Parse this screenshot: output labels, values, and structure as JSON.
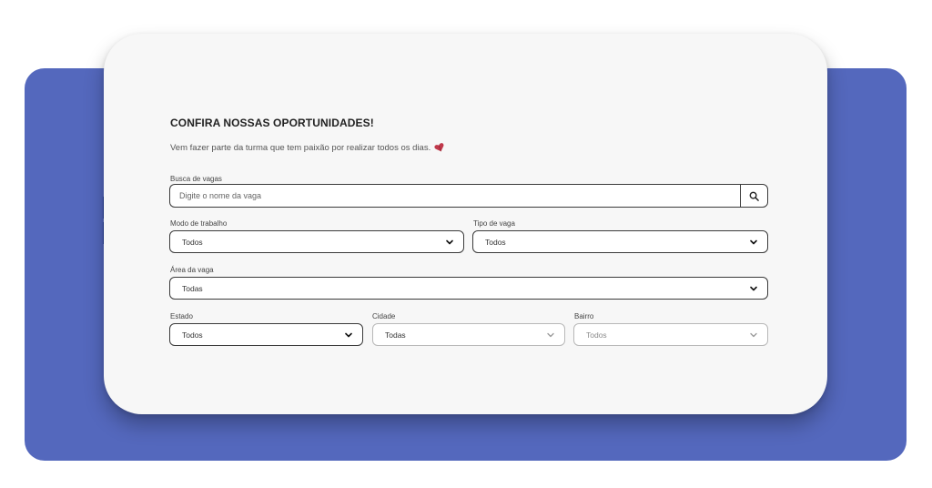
{
  "page": {
    "title": "CONFIRA NOSSAS OPORTUNIDADES!",
    "subtitle": "Vem fazer parte da turma que tem paixão por realizar todos os dias."
  },
  "colors": {
    "background_panel": "#5468bd",
    "card": "#f7f7f7",
    "accessibility_bar": "#1f3a93",
    "heart": "#c0394b"
  },
  "search": {
    "label": "Busca de vagas",
    "placeholder": "Digite o nome da vaga",
    "value": "",
    "button_icon": "search-icon"
  },
  "filters": {
    "modo_trabalho": {
      "label": "Modo de trabalho",
      "value": "Todos"
    },
    "tipo_vaga": {
      "label": "Tipo de vaga",
      "value": "Todos"
    },
    "area_vaga": {
      "label": "Área da vaga",
      "value": "Todas"
    },
    "estado": {
      "label": "Estado",
      "value": "Todos"
    },
    "cidade": {
      "label": "Cidade",
      "value": "Todas"
    },
    "bairro": {
      "label": "Bairro",
      "value": "Todos"
    }
  },
  "accessibility": {
    "icons": [
      "accessibility-icon",
      "sign-language-icon"
    ]
  }
}
